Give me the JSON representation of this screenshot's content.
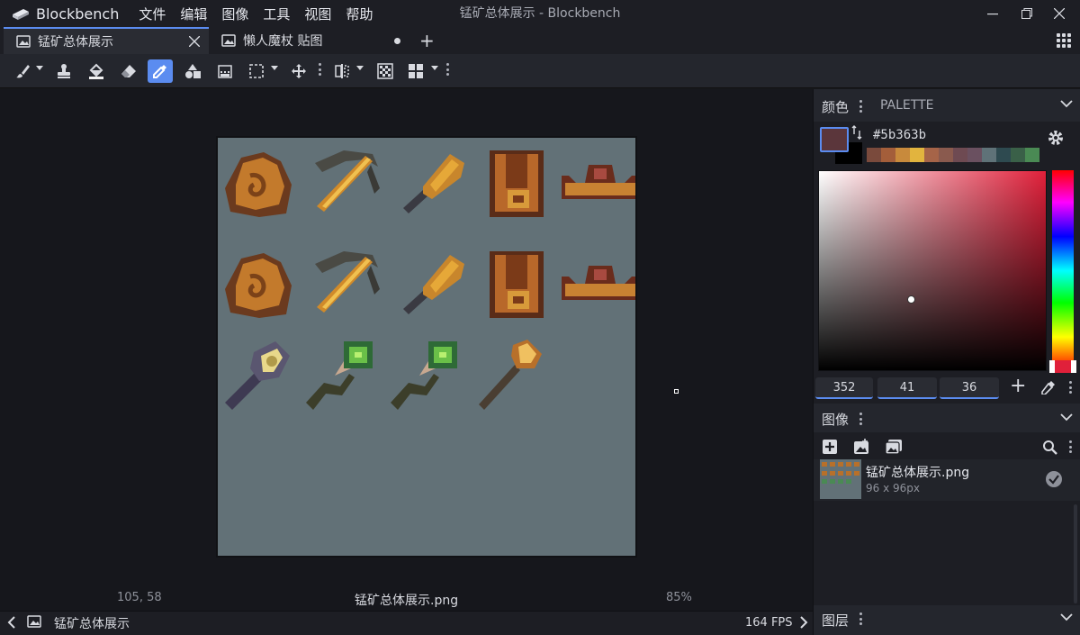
{
  "app": {
    "name": "Blockbench",
    "window_title": "锰矿总体展示 - Blockbench"
  },
  "menu": [
    "文件",
    "编辑",
    "图像",
    "工具",
    "视图",
    "帮助"
  ],
  "tabs": [
    {
      "label": "锰矿总体展示",
      "active": true
    },
    {
      "label": "懒人魔杖 贴图",
      "active": false
    }
  ],
  "toolbar": {
    "tools": [
      "brush-icon",
      "stamp-icon",
      "fill-bucket-icon",
      "eraser-icon",
      "color-picker-icon",
      "shapes-icon",
      "gradient-icon",
      "selection-icon",
      "move-icon",
      "mirror-icon",
      "checkerboard-icon",
      "grid-view-icon"
    ],
    "active_tool": "color-picker-icon"
  },
  "viewport": {
    "cursor_position": "105, 58",
    "file_name": "锰矿总体展示.png",
    "zoom": "85%"
  },
  "bottom": {
    "tab_label": "锰矿总体展示",
    "fps": "164 FPS"
  },
  "color_panel": {
    "title": "颜色",
    "tab2": "PALETTE",
    "hex": "#5b363b",
    "primary_color": "#5b363b",
    "secondary_color": "#000000",
    "palette": [
      "#7a4a3c",
      "#a45e3a",
      "#c88a3c",
      "#e2b43e",
      "#a66448",
      "#8a5a4e",
      "#6e4a52",
      "#6a5060",
      "#5f7278",
      "#2e4a50",
      "#3a6048",
      "#4a8a54"
    ],
    "hue": "352",
    "saturation": "41",
    "value": "36"
  },
  "image_panel": {
    "title": "图像",
    "items": [
      {
        "name": "锰矿总体展示.png",
        "size": "96 x 96px"
      }
    ]
  },
  "layers_panel": {
    "title": "图层"
  },
  "colors": {
    "accent": "#5b8cf0",
    "canvas_bg": "#627177"
  }
}
